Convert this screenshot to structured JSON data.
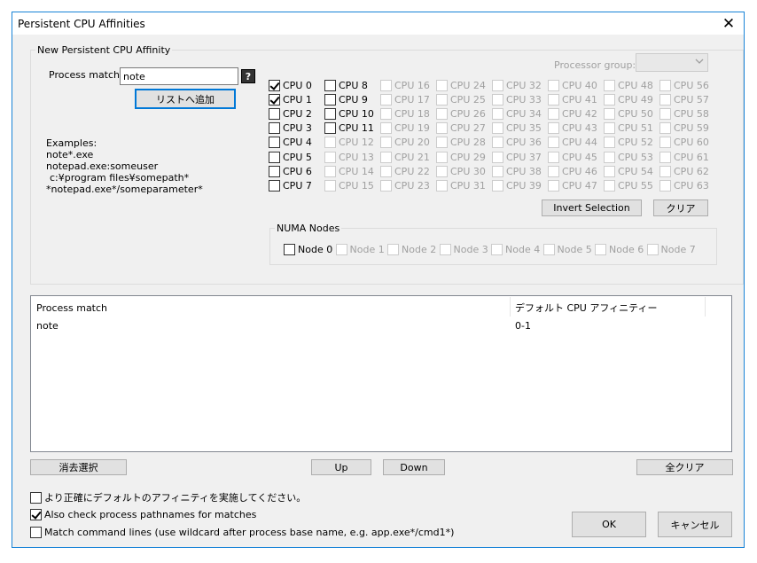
{
  "window": {
    "title": "Persistent CPU Affinities",
    "close_glyph": "✕"
  },
  "new_affinity": {
    "group_label": "New Persistent CPU Affinity",
    "process_match_label": "Process match:",
    "process_match_value": "note",
    "help_glyph": "?",
    "add_button": "リストへ追加",
    "processor_group_label": "Processor group:",
    "processor_group_value": "",
    "examples": [
      "Examples:",
      "note*.exe",
      "notepad.exe:someuser",
      "c:¥program files¥somepath*",
      "*notepad.exe*/someparameter*"
    ],
    "cpus": [
      {
        "label": "CPU 0",
        "checked": true,
        "enabled": true
      },
      {
        "label": "CPU 1",
        "checked": true,
        "enabled": true
      },
      {
        "label": "CPU 2",
        "checked": false,
        "enabled": true
      },
      {
        "label": "CPU 3",
        "checked": false,
        "enabled": true
      },
      {
        "label": "CPU 4",
        "checked": false,
        "enabled": true
      },
      {
        "label": "CPU 5",
        "checked": false,
        "enabled": true
      },
      {
        "label": "CPU 6",
        "checked": false,
        "enabled": true
      },
      {
        "label": "CPU 7",
        "checked": false,
        "enabled": true
      },
      {
        "label": "CPU 8",
        "checked": false,
        "enabled": true
      },
      {
        "label": "CPU 9",
        "checked": false,
        "enabled": true
      },
      {
        "label": "CPU 10",
        "checked": false,
        "enabled": true
      },
      {
        "label": "CPU 11",
        "checked": false,
        "enabled": true
      },
      {
        "label": "CPU 12",
        "checked": false,
        "enabled": false
      },
      {
        "label": "CPU 13",
        "checked": false,
        "enabled": false
      },
      {
        "label": "CPU 14",
        "checked": false,
        "enabled": false
      },
      {
        "label": "CPU 15",
        "checked": false,
        "enabled": false
      },
      {
        "label": "CPU 16",
        "checked": false,
        "enabled": false
      },
      {
        "label": "CPU 17",
        "checked": false,
        "enabled": false
      },
      {
        "label": "CPU 18",
        "checked": false,
        "enabled": false
      },
      {
        "label": "CPU 19",
        "checked": false,
        "enabled": false
      },
      {
        "label": "CPU 20",
        "checked": false,
        "enabled": false
      },
      {
        "label": "CPU 21",
        "checked": false,
        "enabled": false
      },
      {
        "label": "CPU 22",
        "checked": false,
        "enabled": false
      },
      {
        "label": "CPU 23",
        "checked": false,
        "enabled": false
      },
      {
        "label": "CPU 24",
        "checked": false,
        "enabled": false
      },
      {
        "label": "CPU 25",
        "checked": false,
        "enabled": false
      },
      {
        "label": "CPU 26",
        "checked": false,
        "enabled": false
      },
      {
        "label": "CPU 27",
        "checked": false,
        "enabled": false
      },
      {
        "label": "CPU 28",
        "checked": false,
        "enabled": false
      },
      {
        "label": "CPU 29",
        "checked": false,
        "enabled": false
      },
      {
        "label": "CPU 30",
        "checked": false,
        "enabled": false
      },
      {
        "label": "CPU 31",
        "checked": false,
        "enabled": false
      },
      {
        "label": "CPU 32",
        "checked": false,
        "enabled": false
      },
      {
        "label": "CPU 33",
        "checked": false,
        "enabled": false
      },
      {
        "label": "CPU 34",
        "checked": false,
        "enabled": false
      },
      {
        "label": "CPU 35",
        "checked": false,
        "enabled": false
      },
      {
        "label": "CPU 36",
        "checked": false,
        "enabled": false
      },
      {
        "label": "CPU 37",
        "checked": false,
        "enabled": false
      },
      {
        "label": "CPU 38",
        "checked": false,
        "enabled": false
      },
      {
        "label": "CPU 39",
        "checked": false,
        "enabled": false
      },
      {
        "label": "CPU 40",
        "checked": false,
        "enabled": false
      },
      {
        "label": "CPU 41",
        "checked": false,
        "enabled": false
      },
      {
        "label": "CPU 42",
        "checked": false,
        "enabled": false
      },
      {
        "label": "CPU 43",
        "checked": false,
        "enabled": false
      },
      {
        "label": "CPU 44",
        "checked": false,
        "enabled": false
      },
      {
        "label": "CPU 45",
        "checked": false,
        "enabled": false
      },
      {
        "label": "CPU 46",
        "checked": false,
        "enabled": false
      },
      {
        "label": "CPU 47",
        "checked": false,
        "enabled": false
      },
      {
        "label": "CPU 48",
        "checked": false,
        "enabled": false
      },
      {
        "label": "CPU 49",
        "checked": false,
        "enabled": false
      },
      {
        "label": "CPU 50",
        "checked": false,
        "enabled": false
      },
      {
        "label": "CPU 51",
        "checked": false,
        "enabled": false
      },
      {
        "label": "CPU 52",
        "checked": false,
        "enabled": false
      },
      {
        "label": "CPU 53",
        "checked": false,
        "enabled": false
      },
      {
        "label": "CPU 54",
        "checked": false,
        "enabled": false
      },
      {
        "label": "CPU 55",
        "checked": false,
        "enabled": false
      },
      {
        "label": "CPU 56",
        "checked": false,
        "enabled": false
      },
      {
        "label": "CPU 57",
        "checked": false,
        "enabled": false
      },
      {
        "label": "CPU 58",
        "checked": false,
        "enabled": false
      },
      {
        "label": "CPU 59",
        "checked": false,
        "enabled": false
      },
      {
        "label": "CPU 60",
        "checked": false,
        "enabled": false
      },
      {
        "label": "CPU 61",
        "checked": false,
        "enabled": false
      },
      {
        "label": "CPU 62",
        "checked": false,
        "enabled": false
      },
      {
        "label": "CPU 63",
        "checked": false,
        "enabled": false
      }
    ],
    "invert_button": "Invert Selection",
    "clear_button": "クリア",
    "numa_label": "NUMA Nodes",
    "numa_nodes": [
      {
        "label": "Node 0",
        "checked": false,
        "enabled": true
      },
      {
        "label": "Node 1",
        "checked": false,
        "enabled": false
      },
      {
        "label": "Node 2",
        "checked": false,
        "enabled": false
      },
      {
        "label": "Node 3",
        "checked": false,
        "enabled": false
      },
      {
        "label": "Node 4",
        "checked": false,
        "enabled": false
      },
      {
        "label": "Node 5",
        "checked": false,
        "enabled": false
      },
      {
        "label": "Node 6",
        "checked": false,
        "enabled": false
      },
      {
        "label": "Node 7",
        "checked": false,
        "enabled": false
      }
    ]
  },
  "list": {
    "columns": [
      "Process match",
      "デフォルト CPU アフィニティー"
    ],
    "rows": [
      {
        "process_match": "note",
        "affinity": "0-1"
      }
    ]
  },
  "list_buttons": {
    "remove": "消去選択",
    "up": "Up",
    "down": "Down",
    "clear_all": "全クリア"
  },
  "options": [
    {
      "label": "より正確にデフォルトのアフィニティを実施してください。",
      "checked": false
    },
    {
      "label": "Also check process pathnames for matches",
      "checked": true
    },
    {
      "label": "Match command lines (use wildcard after process base name, e.g. app.exe*/cmd1*)",
      "checked": false
    }
  ],
  "dialog_buttons": {
    "ok": "OK",
    "cancel": "キャンセル"
  }
}
